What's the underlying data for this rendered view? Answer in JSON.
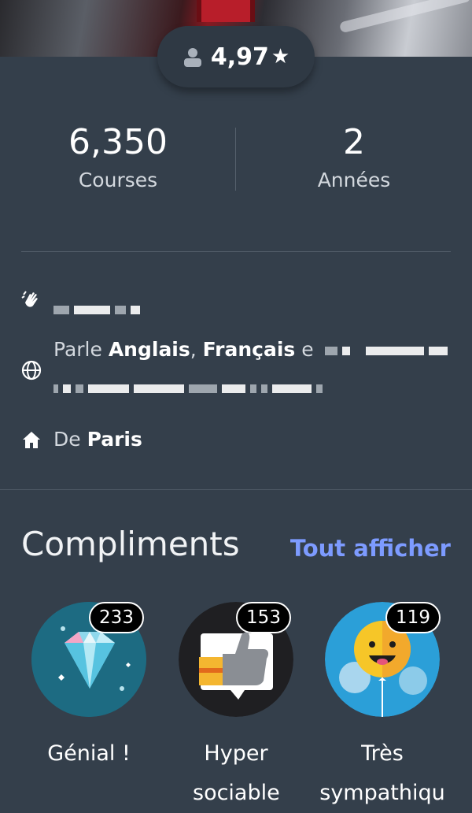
{
  "header": {
    "rating": "4,97",
    "rating_star": "★"
  },
  "stats": [
    {
      "value": "6,350",
      "label": "Courses"
    },
    {
      "value": "2",
      "label": "Années"
    }
  ],
  "profile": {
    "languages_prefix": "Parle ",
    "language_1": "Anglais",
    "separator": ", ",
    "language_2": "Français",
    "languages_suffix": " e",
    "from_prefix": "De ",
    "city": "Paris"
  },
  "compliments": {
    "title": "Compliments",
    "see_all": "Tout afficher",
    "items": [
      {
        "count": "233",
        "label": "Génial !"
      },
      {
        "count": "153",
        "label": "Hyper sociable"
      },
      {
        "count": "119",
        "label": "Très sympathiqu"
      }
    ]
  },
  "colors": {
    "background": "#343f4b",
    "link": "#7d9bff"
  }
}
